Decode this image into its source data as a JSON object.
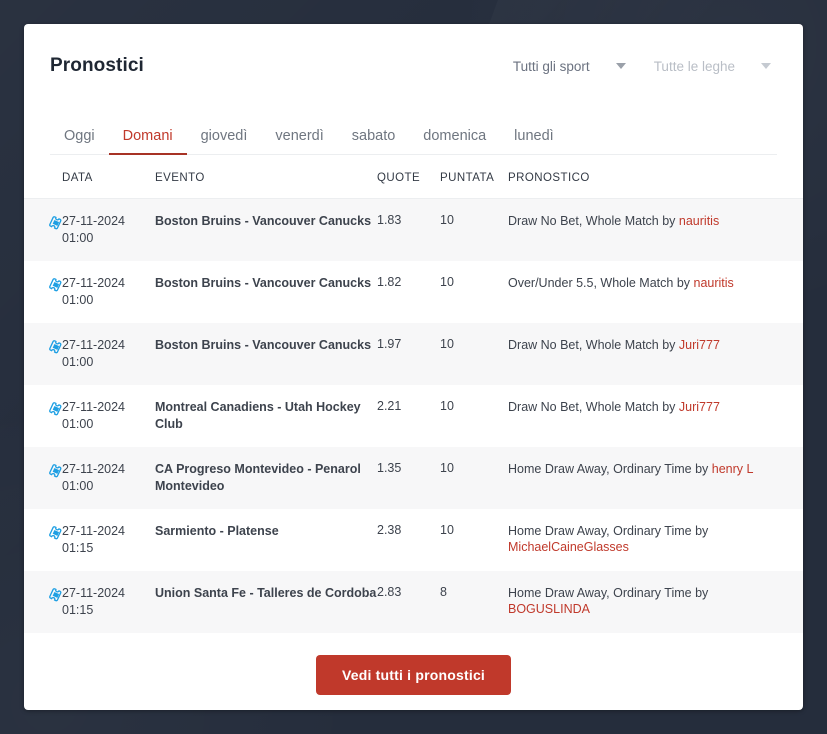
{
  "theme": {
    "page_background": "#252d3c",
    "card_background": "#ffffff",
    "accent_red": "#c0392b",
    "ticket_icon_blue": "#1e9fe3",
    "row_alt_background": "#f7f7f8"
  },
  "header": {
    "title": "Pronostici",
    "filters": [
      {
        "label": "Tutti gli sport",
        "muted": false,
        "icon": "chevron-down-icon"
      },
      {
        "label": "Tutte le leghe",
        "muted": true,
        "icon": "chevron-down-icon"
      }
    ]
  },
  "tabs": [
    {
      "label": "Oggi",
      "active": false
    },
    {
      "label": "Domani",
      "active": true
    },
    {
      "label": "giovedì",
      "active": false
    },
    {
      "label": "venerdì",
      "active": false
    },
    {
      "label": "sabato",
      "active": false
    },
    {
      "label": "domenica",
      "active": false
    },
    {
      "label": "lunedì",
      "active": false
    }
  ],
  "table": {
    "columns": [
      "",
      "DATA",
      "EVENTO",
      "QUOTE",
      "PUNTATA",
      "PRONOSTICO"
    ],
    "rows": [
      {
        "icon": "ticket-icon",
        "date": "27-11-2024",
        "time": "01:00",
        "event": "Boston Bruins - Vancouver Canucks",
        "quote": "1.83",
        "stake": "10",
        "prediction_text": "Draw No Bet, Whole Match by",
        "prediction_user": "nauritis"
      },
      {
        "icon": "ticket-icon",
        "date": "27-11-2024",
        "time": "01:00",
        "event": "Boston Bruins - Vancouver Canucks",
        "quote": "1.82",
        "stake": "10",
        "prediction_text": "Over/Under 5.5, Whole Match by",
        "prediction_user": "nauritis"
      },
      {
        "icon": "ticket-icon",
        "date": "27-11-2024",
        "time": "01:00",
        "event": "Boston Bruins - Vancouver Canucks",
        "quote": "1.97",
        "stake": "10",
        "prediction_text": "Draw No Bet, Whole Match by",
        "prediction_user": "Juri777"
      },
      {
        "icon": "ticket-icon",
        "date": "27-11-2024",
        "time": "01:00",
        "event": "Montreal Canadiens - Utah Hockey Club",
        "quote": "2.21",
        "stake": "10",
        "prediction_text": "Draw No Bet, Whole Match by",
        "prediction_user": "Juri777"
      },
      {
        "icon": "ticket-icon",
        "date": "27-11-2024",
        "time": "01:00",
        "event": "CA Progreso Montevideo - Penarol Montevideo",
        "quote": "1.35",
        "stake": "10",
        "prediction_text": "Home Draw Away, Ordinary Time by",
        "prediction_user": "henry L"
      },
      {
        "icon": "ticket-icon",
        "date": "27-11-2024",
        "time": "01:15",
        "event": "Sarmiento - Platense",
        "quote": "2.38",
        "stake": "10",
        "prediction_text": "Home Draw Away, Ordinary Time by",
        "prediction_user": "MichaelCaineGlasses"
      },
      {
        "icon": "ticket-icon",
        "date": "27-11-2024",
        "time": "01:15",
        "event": "Union Santa Fe - Talleres de Cordoba",
        "quote": "2.83",
        "stake": "8",
        "prediction_text": "Home Draw Away, Ordinary Time by",
        "prediction_user": "BOGUSLINDA"
      }
    ]
  },
  "footer": {
    "cta_label": "Vedi tutti i pronostici"
  }
}
